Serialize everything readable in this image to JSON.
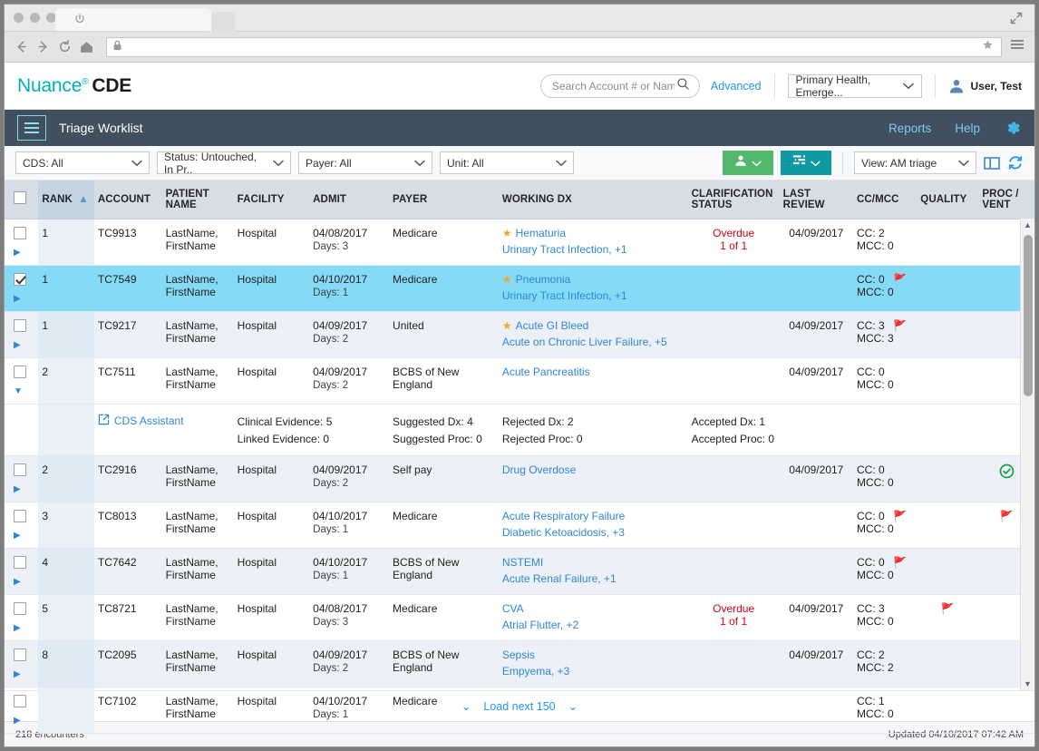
{
  "browser": {
    "back_icon": "back-arrow-icon",
    "forward_icon": "forward-arrow-icon",
    "reload_icon": "reload-icon",
    "home_icon": "home-icon",
    "lock_icon": "lock-icon",
    "star_icon": "star-bookmark-icon",
    "menu_icon": "hamburger-menu-icon",
    "url_value": "",
    "tab_icon": "power-icon"
  },
  "header": {
    "logo_text": "Nuance",
    "logo_sup": "®",
    "logo_bold": "CDE",
    "search_placeholder": "Search Account # or Name",
    "search_value": "",
    "advanced_label": "Advanced",
    "facility_value": "Primary Health, Emerge...",
    "user_name": "User, Test"
  },
  "navbar": {
    "title": "Triage Worklist",
    "reports_label": "Reports",
    "help_label": "Help"
  },
  "filters": [
    {
      "label": "CDS: All"
    },
    {
      "label": "Status: Untouched, In Pr.."
    },
    {
      "label": "Payer: All"
    },
    {
      "label": "Unit: All"
    }
  ],
  "toolbar": {
    "assign_icon": "person-icon",
    "list_icon": "list-lines-icon",
    "view_label": "View: AM triage",
    "columns_icon": "columns-layout-icon",
    "refresh_icon": "refresh-icon"
  },
  "table": {
    "columns": [
      {
        "key": "check",
        "label": ""
      },
      {
        "key": "rank",
        "label": "RANK"
      },
      {
        "key": "account",
        "label": "ACCOUNT"
      },
      {
        "key": "name",
        "label": "PATIENT NAME"
      },
      {
        "key": "facility",
        "label": "FACILITY"
      },
      {
        "key": "admit",
        "label": "ADMIT"
      },
      {
        "key": "payer",
        "label": "PAYER"
      },
      {
        "key": "dx",
        "label": "WORKING DX"
      },
      {
        "key": "clar",
        "label": "CLARIFICATION STATUS"
      },
      {
        "key": "review",
        "label": "LAST REVIEW"
      },
      {
        "key": "ccmcc",
        "label": "CC/MCC"
      },
      {
        "key": "quality",
        "label": "QUALITY"
      },
      {
        "key": "proc",
        "label": "PROC / VENT"
      }
    ],
    "sort_indicator": "▲",
    "rows": [
      {
        "checked": false,
        "expanded": false,
        "selected": false,
        "alt": false,
        "rank": "1",
        "account": "TC9913",
        "name_last": "LastName,",
        "name_first": "FirstName",
        "facility": "Hospital",
        "admit_date": "04/08/2017",
        "admit_days": "Days: 3",
        "payer": "Medicare",
        "dx_primary": "Hematuria",
        "dx_star": true,
        "dx_secondary": "Urinary Tract Infection, +1",
        "clar_status": "Overdue",
        "clar_count": "1 of 1",
        "last_review": "04/09/2017",
        "cc": "CC: 2",
        "mcc": "MCC: 0",
        "cc_flag": false,
        "quality_flag": false,
        "proc_flag": false,
        "proc_check": false
      },
      {
        "checked": true,
        "expanded": false,
        "selected": true,
        "alt": false,
        "rank": "1",
        "account": "TC7549",
        "name_last": "LastName,",
        "name_first": "FirstName",
        "facility": "Hospital",
        "admit_date": "04/10/2017",
        "admit_days": "Days: 1",
        "payer": "Medicare",
        "dx_primary": "Pneumonia",
        "dx_star": true,
        "dx_secondary": "Urinary Tract Infection, +1",
        "clar_status": "",
        "clar_count": "",
        "last_review": "",
        "cc": "CC: 0",
        "mcc": "MCC: 0",
        "cc_flag": true,
        "quality_flag": false,
        "proc_flag": false,
        "proc_check": false
      },
      {
        "checked": false,
        "expanded": false,
        "selected": false,
        "alt": true,
        "rank": "1",
        "account": "TC9217",
        "name_last": "LastName,",
        "name_first": "FirstName",
        "facility": "Hospital",
        "admit_date": "04/09/2017",
        "admit_days": "Days: 2",
        "payer": "United",
        "dx_primary": "Acute GI Bleed",
        "dx_star": true,
        "dx_secondary": "Acute on Chronic Liver Failure, +5",
        "clar_status": "",
        "clar_count": "",
        "last_review": "04/09/2017",
        "cc": "CC: 3",
        "mcc": "MCC: 3",
        "cc_flag": true,
        "quality_flag": false,
        "proc_flag": false,
        "proc_check": false
      },
      {
        "checked": false,
        "expanded": true,
        "selected": false,
        "alt": false,
        "rank": "2",
        "account": "TC7511",
        "name_last": "LastName,",
        "name_first": "FirstName",
        "facility": "Hospital",
        "admit_date": "04/09/2017",
        "admit_days": "Days: 2",
        "payer": "BCBS of New England",
        "dx_primary": "",
        "dx_star": false,
        "dx_secondary": "Acute Pancreatitis",
        "clar_status": "",
        "clar_count": "",
        "last_review": "04/09/2017",
        "cc": "CC: 0",
        "mcc": "MCC: 0",
        "cc_flag": false,
        "quality_flag": false,
        "proc_flag": false,
        "proc_check": false
      },
      {
        "checked": false,
        "expanded": false,
        "selected": false,
        "alt": true,
        "rank": "2",
        "account": "TC2916",
        "name_last": "LastName,",
        "name_first": "FirstName",
        "facility": "Hospital",
        "admit_date": "04/09/2017",
        "admit_days": "Days: 2",
        "payer": "Self pay",
        "dx_primary": "",
        "dx_star": false,
        "dx_secondary": "Drug Overdose",
        "clar_status": "",
        "clar_count": "",
        "last_review": "04/09/2017",
        "cc": "CC: 0",
        "mcc": "MCC: 0",
        "cc_flag": false,
        "quality_flag": false,
        "proc_flag": false,
        "proc_check": true
      },
      {
        "checked": false,
        "expanded": false,
        "selected": false,
        "alt": false,
        "rank": "3",
        "account": "TC8013",
        "name_last": "LastName,",
        "name_first": "FirstName",
        "facility": "Hospital",
        "admit_date": "04/10/2017",
        "admit_days": "Days: 1",
        "payer": "Medicare",
        "dx_primary": "",
        "dx_star": false,
        "dx_secondary": "Acute Respiratory Failure",
        "dx_third": "Diabetic Ketoacidosis, +3",
        "clar_status": "",
        "clar_count": "",
        "last_review": "",
        "cc": "CC: 0",
        "mcc": "MCC: 0",
        "cc_flag": true,
        "quality_flag": false,
        "proc_flag": true,
        "proc_check": false
      },
      {
        "checked": false,
        "expanded": false,
        "selected": false,
        "alt": true,
        "rank": "4",
        "account": "TC7642",
        "name_last": "LastName,",
        "name_first": "FirstName",
        "facility": "Hospital",
        "admit_date": "04/10/2017",
        "admit_days": "Days: 1",
        "payer": "BCBS of New England",
        "dx_primary": "",
        "dx_star": false,
        "dx_secondary": "NSTEMI",
        "dx_third": "Acute Renal Failure, +1",
        "clar_status": "",
        "clar_count": "",
        "last_review": "",
        "cc": "CC: 0",
        "mcc": "MCC: 0",
        "cc_flag": true,
        "quality_flag": false,
        "proc_flag": false,
        "proc_check": false
      },
      {
        "checked": false,
        "expanded": false,
        "selected": false,
        "alt": false,
        "rank": "5",
        "account": "TC8721",
        "name_last": "LastName,",
        "name_first": "FirstName",
        "facility": "Hospital",
        "admit_date": "04/08/2017",
        "admit_days": "Days: 3",
        "payer": "Medicare",
        "dx_primary": "",
        "dx_star": false,
        "dx_secondary": "CVA",
        "dx_third": "Atrial Flutter, +2",
        "clar_status": "Overdue",
        "clar_count": "1 of 1",
        "last_review": "04/09/2017",
        "cc": "CC: 3",
        "mcc": "MCC: 0",
        "cc_flag": false,
        "quality_flag": true,
        "proc_flag": false,
        "proc_check": false
      },
      {
        "checked": false,
        "expanded": false,
        "selected": false,
        "alt": true,
        "rank": "8",
        "account": "TC2095",
        "name_last": "LastName,",
        "name_first": "FirstName",
        "facility": "Hospital",
        "admit_date": "04/09/2017",
        "admit_days": "Days: 2",
        "payer": "BCBS of New England",
        "dx_primary": "",
        "dx_star": false,
        "dx_secondary": "Sepsis",
        "dx_third": "Empyema, +3",
        "clar_status": "",
        "clar_count": "",
        "last_review": "04/09/2017",
        "cc": "CC: 2",
        "mcc": "MCC: 2",
        "cc_flag": false,
        "quality_flag": false,
        "proc_flag": false,
        "proc_check": false
      },
      {
        "checked": false,
        "expanded": false,
        "selected": false,
        "alt": false,
        "rank": "",
        "account": "TC7102",
        "name_last": "LastName,",
        "name_first": "FirstName",
        "facility": "Hospital",
        "admit_date": "04/10/2017",
        "admit_days": "Days: 1",
        "payer": "Medicare",
        "dx_primary": "",
        "dx_star": false,
        "dx_secondary": "",
        "clar_status": "",
        "clar_count": "",
        "last_review": "",
        "cc": "CC: 1",
        "mcc": "MCC: 0",
        "cc_flag": false,
        "quality_flag": false,
        "proc_flag": false,
        "proc_check": false
      }
    ],
    "cds_panel": {
      "link_label": "CDS Assistant",
      "link_icon": "external-link-icon",
      "stats": [
        {
          "label_a": "Clinical Evidence:",
          "value_a": "5",
          "label_b": "Linked Evidence:",
          "value_b": "0"
        },
        {
          "label_a": "Suggested Dx:",
          "value_a": "4",
          "label_b": "Suggested Proc:",
          "value_b": "0"
        },
        {
          "label_a": "Rejected Dx:",
          "value_a": "2",
          "label_b": "Rejected Proc:",
          "value_b": "0"
        },
        {
          "label_a": "Accepted Dx:",
          "value_a": "1",
          "label_b": "Accepted Proc:",
          "value_b": "0"
        }
      ]
    }
  },
  "footer": {
    "load_more_label": "Load next 150",
    "encounters": "218 encounters",
    "updated": "Updated 04/10/2017 07:42 AM"
  },
  "colors": {
    "brand_teal": "#00b0b9",
    "navbar": "#41505f",
    "link_blue": "#2f86d6",
    "selected_row": "#85dbf5",
    "flag_red": "#e02020",
    "star_orange": "#f5a623",
    "green_button": "#52b86b",
    "teal_button": "#0f9aa3"
  }
}
